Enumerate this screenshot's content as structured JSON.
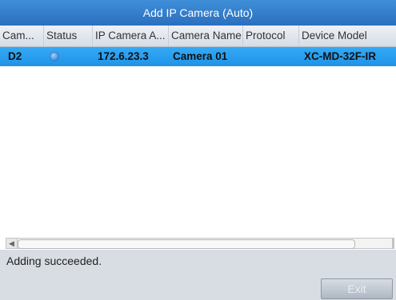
{
  "window": {
    "title": "Add IP Camera (Auto)"
  },
  "table": {
    "columns": [
      "Cam...",
      "Status",
      "IP Camera A...",
      "Camera Name",
      "Protocol",
      "Device Model"
    ],
    "rows": [
      {
        "camera": "D2",
        "status": "blue-dot",
        "ip": "172.6.23.3",
        "camera_name": "Camera 01",
        "protocol": "",
        "device_model": "XC-MD-32F-IR"
      }
    ]
  },
  "status": {
    "message": "Adding succeeded."
  },
  "buttons": {
    "exit": "Exit"
  },
  "colors": {
    "title_bar": "#2a6fbf",
    "selected_row": "#1e94e8",
    "status_dot": "#3b8fe0"
  }
}
